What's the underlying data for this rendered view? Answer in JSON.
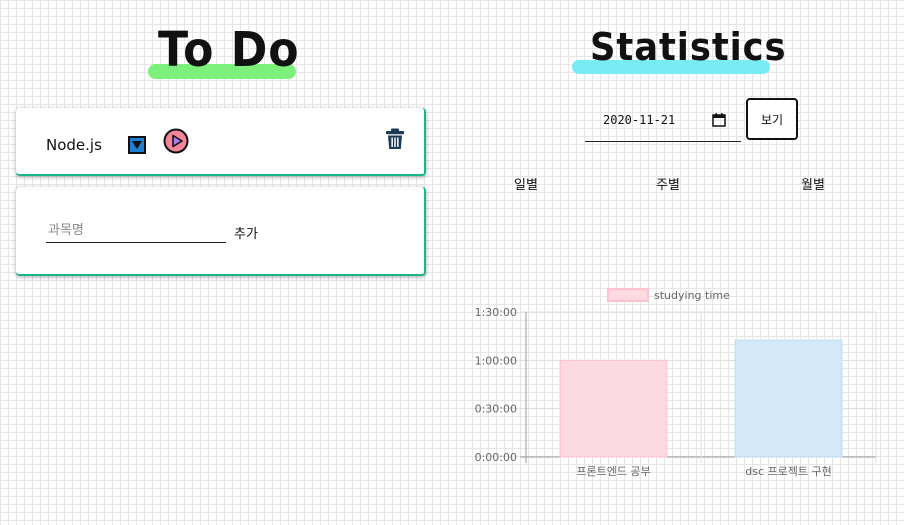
{
  "todo": {
    "title": "To Do",
    "subject": {
      "name": "Node.js"
    },
    "add_form": {
      "placeholder": "과목명",
      "add_label": "추가"
    }
  },
  "stats": {
    "title": "Statistics",
    "date_value": "2020-11-21",
    "view_label": "보기",
    "tabs": [
      "일별",
      "주별",
      "월별"
    ]
  },
  "chart_data": {
    "type": "bar",
    "categories": [
      "프론트엔드 공부",
      "dsc 프로젝트 구현"
    ],
    "series": [
      {
        "name": "studying time",
        "values": [
          3600,
          4350
        ],
        "colors": [
          "#fdd9e1",
          "#d3e9f8"
        ],
        "borders": [
          "#fbc2cf",
          "#b9dbf3"
        ]
      }
    ],
    "y_ticks": [
      {
        "value": 0,
        "label": "0:00:00"
      },
      {
        "value": 1800,
        "label": "0:30:00"
      },
      {
        "value": 3600,
        "label": "1:00:00"
      },
      {
        "value": 5400,
        "label": "1:30:00"
      }
    ],
    "ylim": [
      0,
      5400
    ],
    "legend_position": "top"
  }
}
